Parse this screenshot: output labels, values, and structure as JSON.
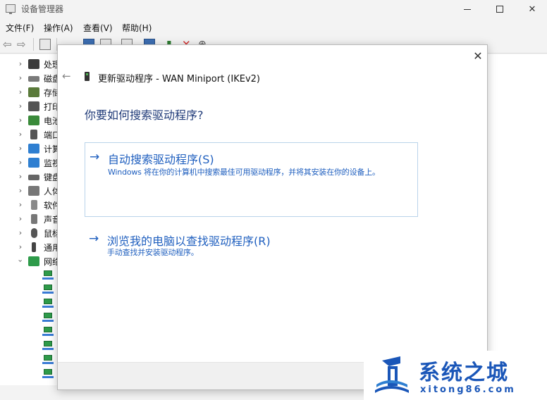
{
  "window": {
    "title": "设备管理器"
  },
  "menubar": {
    "items": [
      "文件(F)",
      "操作(A)",
      "查看(V)",
      "帮助(H)"
    ]
  },
  "tree": {
    "categories": [
      {
        "label": "处理",
        "icon": "processor-icon",
        "color": "#3b3b3b"
      },
      {
        "label": "磁盘",
        "icon": "disk-drive-icon",
        "color": "#7a7a7a"
      },
      {
        "label": "存储",
        "icon": "storage-controller-icon",
        "color": "#5a7a3a"
      },
      {
        "label": "打印",
        "icon": "printer-icon",
        "color": "#555555"
      },
      {
        "label": "电池",
        "icon": "battery-icon",
        "color": "#3a8a3a"
      },
      {
        "label": "端口",
        "icon": "port-icon",
        "color": "#555555"
      },
      {
        "label": "计算",
        "icon": "computer-icon",
        "color": "#2f7fd1"
      },
      {
        "label": "监视",
        "icon": "monitor-icon",
        "color": "#2f7fd1"
      },
      {
        "label": "键盘",
        "icon": "keyboard-icon",
        "color": "#666666"
      },
      {
        "label": "人体",
        "icon": "human-interface-icon",
        "color": "#777777"
      },
      {
        "label": "软件",
        "icon": "software-device-icon",
        "color": "#8a8a8a"
      },
      {
        "label": "声音",
        "icon": "sound-icon",
        "color": "#777777"
      },
      {
        "label": "鼠标",
        "icon": "mouse-icon",
        "color": "#555555"
      },
      {
        "label": "通用",
        "icon": "usb-icon",
        "color": "#444444"
      },
      {
        "label": "网络",
        "icon": "network-adapter-icon",
        "color": "#2e9b4a"
      }
    ]
  },
  "dialog": {
    "title": "更新驱动程序 - WAN Miniport (IKEv2)",
    "heading": "你要如何搜索驱动程序?",
    "close_glyph": "✕",
    "back_glyph": "←",
    "options": [
      {
        "arrow": "→",
        "title": "自动搜索驱动程序(S)",
        "description": "Windows 将在你的计算机中搜索最佳可用驱动程序，并将其安装在你的设备上。"
      },
      {
        "arrow": "→",
        "title": "浏览我的电脑以查找驱动程序(R)",
        "description": "手动查找并安装驱动程序。"
      }
    ]
  },
  "watermark": {
    "name": "系统之城",
    "url": "xitong86.com"
  },
  "colors": {
    "accent": "#1f5fbf",
    "heading": "#1f3a78",
    "watermark": "#1a56b8"
  }
}
